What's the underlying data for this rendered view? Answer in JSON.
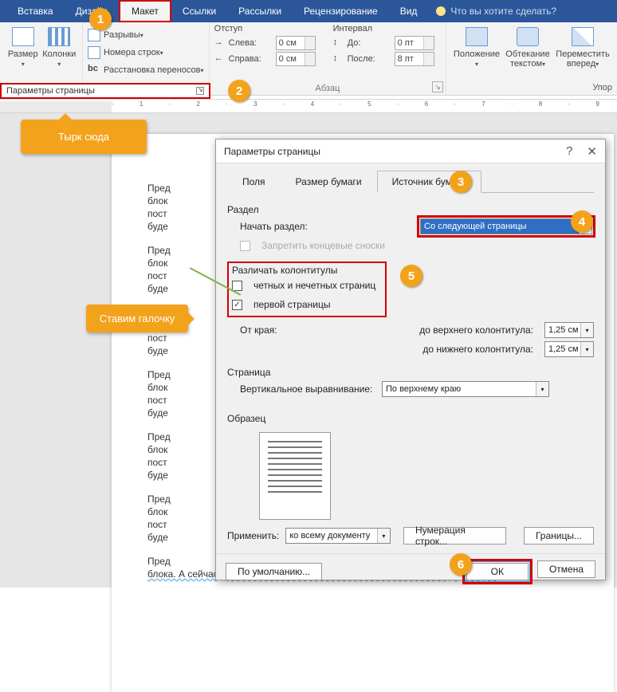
{
  "tabs": [
    "Вставка",
    "Дизайн",
    "Макет",
    "Ссылки",
    "Рассылки",
    "Рецензирование",
    "Вид"
  ],
  "active_tab_index": 2,
  "tellme": "Что вы хотите сделать?",
  "ribbon": {
    "size_label": "Размер",
    "columns_label": "Колонки",
    "breaks": "Разрывы",
    "linenum": "Номера строк",
    "hyphen": "Расстановка переносов",
    "group1_title": "Параметры страницы",
    "indent_title": "Отступ",
    "interval_title": "Интервал",
    "left_label": "Слева:",
    "right_label": "Справа:",
    "before_label": "До:",
    "after_label": "После:",
    "left_val": "0 см",
    "right_val": "0 см",
    "before_val": "0 пт",
    "after_val": "8 пт",
    "para_title": "Абзац",
    "position_label": "Положение",
    "wrap_label": "Обтекание текстом",
    "move_label": "Переместить вперед",
    "arrange_title": "Упор"
  },
  "callouts": {
    "c1": "Тырк сюда",
    "c2": "Ставим галочку"
  },
  "nums": [
    "1",
    "2",
    "3",
    "4",
    "5",
    "6"
  ],
  "dialog": {
    "title": "Параметры страницы",
    "tabs": [
      "Поля",
      "Размер бумаги",
      "Источник бумаги"
    ],
    "active": 2,
    "section_razdel": "Раздел",
    "start_label": "Начать раздел:",
    "start_value": "Со следующей страницы",
    "suppress": "Запретить концевые сноски",
    "headers_title": "Различать колонтитулы",
    "odd_even": "четных и нечетных страниц",
    "first_page": "первой страницы",
    "from_edge": "От края:",
    "header_dist_label": "до верхнего колонтитула:",
    "footer_dist_label": "до нижнего колонтитула:",
    "header_dist": "1,25 см",
    "footer_dist": "1,25 см",
    "page_title": "Страница",
    "valign_label": "Вертикальное выравнивание:",
    "valign_value": "По верхнему краю",
    "sample": "Образец",
    "apply_label": "Применить:",
    "apply_value": "ко всему документу",
    "linenum_btn": "Нумерация строк...",
    "borders_btn": "Границы...",
    "default_btn": "По умолчанию...",
    "ok": "ОК",
    "cancel": "Отмена"
  },
  "paragraphs": {
    "p1": "Пред",
    "p2": "блок",
    "p3": "пост",
    "p4": "буде",
    "long": "блока. А сейчас для более полного заполнения блока текстовой информацией"
  }
}
